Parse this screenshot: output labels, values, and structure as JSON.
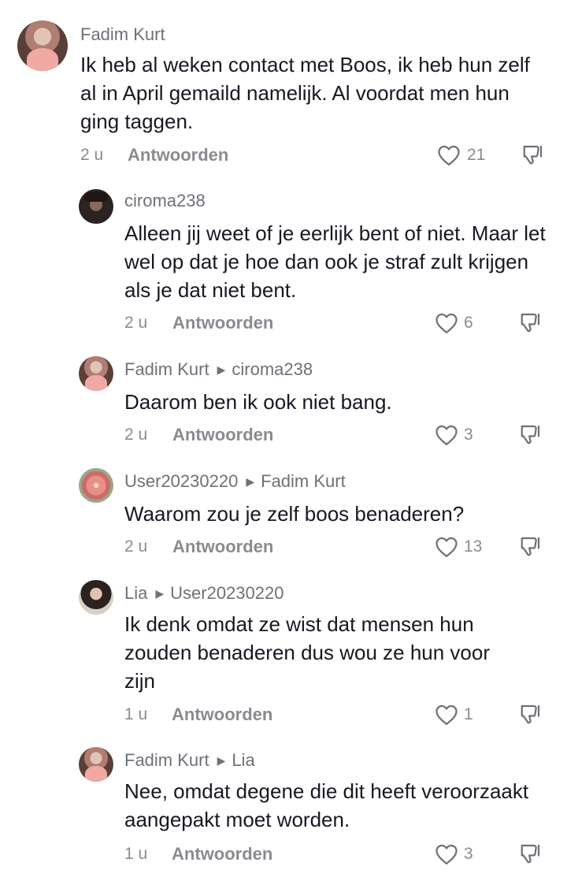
{
  "reply_label": "Antwoorden",
  "comments": [
    {
      "author": "Fadim Kurt",
      "reply_to": "",
      "text": "Ik heb al weken contact met Boos, ik heb hun zelf al in April gemaild namelijk. Al voordat men hun ging taggen.",
      "time": "2 u",
      "likes": "21",
      "avatar": "avatar-fadim-kurt"
    },
    {
      "author": "ciroma238",
      "reply_to": "",
      "text": "Alleen jij weet of je eerlijk bent of niet. Maar let wel op dat je hoe dan ook je straf zult krijgen als je dat niet bent.",
      "time": "2 u",
      "likes": "6",
      "avatar": "avatar-ciroma238"
    },
    {
      "author": "Fadim Kurt",
      "reply_to": "ciroma238",
      "text": "Daarom ben ik ook niet bang.",
      "time": "2 u",
      "likes": "3",
      "avatar": "avatar-fadim-kurt"
    },
    {
      "author": "User20230220",
      "reply_to": "Fadim Kurt",
      "text": "Waarom zou je zelf boos benaderen?",
      "time": "2 u",
      "likes": "13",
      "avatar": "avatar-user20230220"
    },
    {
      "author": "Lia",
      "reply_to": "User20230220",
      "text": "Ik denk omdat ze wist dat mensen hun zouden benaderen dus wou ze hun voor zijn",
      "time": "1 u",
      "likes": "1",
      "avatar": "avatar-lia"
    },
    {
      "author": "Fadim Kurt",
      "reply_to": "Lia",
      "text": "Nee, omdat degene die dit heeft veroorzaakt aangepakt moet worden.",
      "time": "1 u",
      "likes": "3",
      "avatar": "avatar-fadim-kurt"
    }
  ]
}
